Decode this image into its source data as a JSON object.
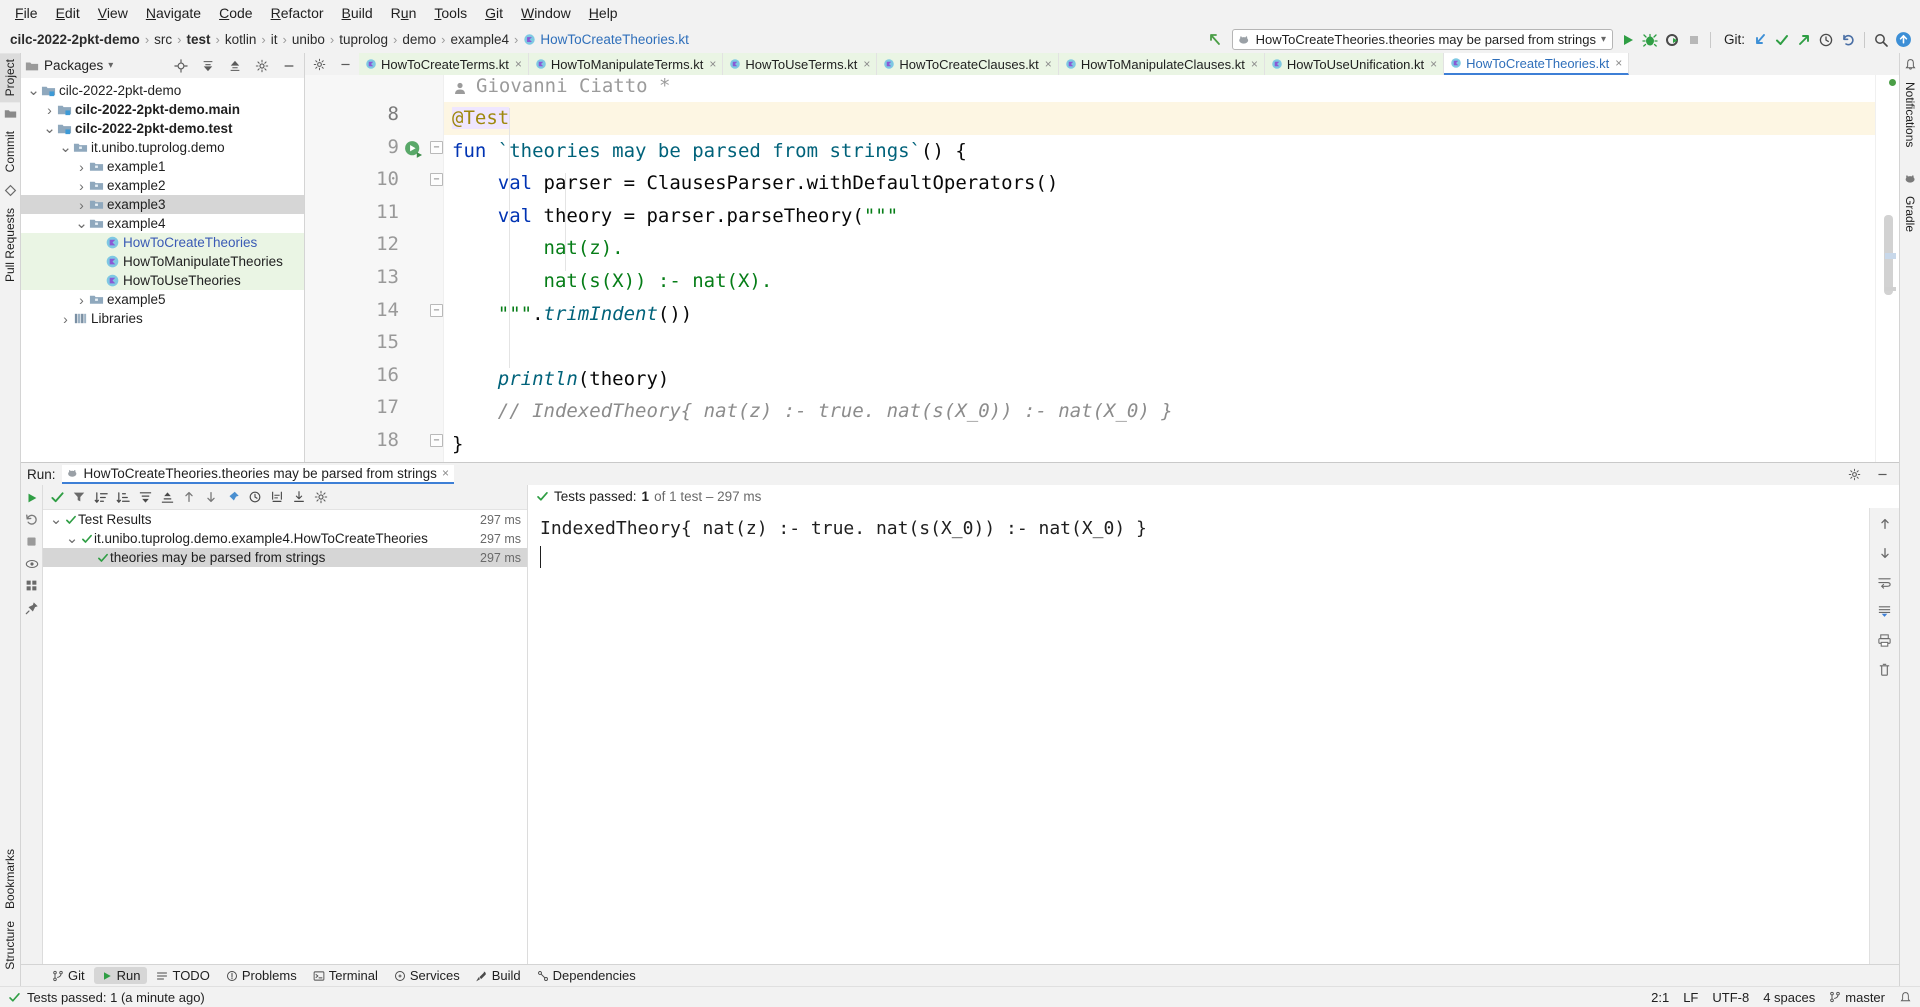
{
  "menu": {
    "items": [
      {
        "label": "File",
        "mn": "F"
      },
      {
        "label": "Edit",
        "mn": "E"
      },
      {
        "label": "View",
        "mn": "V"
      },
      {
        "label": "Navigate",
        "mn": "N"
      },
      {
        "label": "Code",
        "mn": "C"
      },
      {
        "label": "Refactor",
        "mn": "R"
      },
      {
        "label": "Build",
        "mn": "B"
      },
      {
        "label": "Run",
        "mn": "u"
      },
      {
        "label": "Tools",
        "mn": "T"
      },
      {
        "label": "Git",
        "mn": "G"
      },
      {
        "label": "Window",
        "mn": "W"
      },
      {
        "label": "Help",
        "mn": "H"
      }
    ]
  },
  "breadcrumb": {
    "items": [
      "cilc-2022-2pkt-demo",
      "src",
      "test",
      "kotlin",
      "it",
      "unibo",
      "tuprolog",
      "demo",
      "example4",
      "HowToCreateTheories.kt"
    ],
    "bold_indices": [
      0,
      2
    ],
    "link_index": 9,
    "separator": "›"
  },
  "toolbar": {
    "run_config": "HowToCreateTheories.theories may be parsed from strings",
    "run_config_dropdown": "▾",
    "run_label": "Run",
    "debug_label": "Debug",
    "coverage_label": "Run with Coverage",
    "stop_label": "Stop",
    "git_label": "Git:",
    "git_update_label": "Update Project",
    "git_commit_label": "Commit",
    "git_push_label": "Push",
    "git_history_label": "History",
    "git_revert_label": "Rollback",
    "search_label": "Search Everywhere",
    "account_label": "Account"
  },
  "left_stripe": {
    "project_tab": "Project",
    "commit_tab": "Commit",
    "pull_requests_tab": "Pull Requests",
    "bookmarks_tab": "Bookmarks",
    "structure_tab": "Structure"
  },
  "right_stripe": {
    "notifications_tab": "Notifications",
    "gradle_tab": "Gradle"
  },
  "project_panel": {
    "title": "Packages",
    "title_dropdown": "▾",
    "locate_label": "Select Opened File",
    "expand_label": "Expand All",
    "collapse_label": "Collapse All",
    "settings_label": "Options",
    "hide_label": "Hide",
    "tree": [
      {
        "label": "cilc-2022-2pkt-demo",
        "indent": 0,
        "arrow": "down",
        "icon": "module",
        "bold": false,
        "state": "normal"
      },
      {
        "label": "cilc-2022-2pkt-demo.main",
        "indent": 1,
        "arrow": "right",
        "icon": "module",
        "bold": true,
        "state": "normal"
      },
      {
        "label": "cilc-2022-2pkt-demo.test",
        "indent": 1,
        "arrow": "down",
        "icon": "module",
        "bold": true,
        "state": "normal"
      },
      {
        "label": "it.unibo.tuprolog.demo",
        "indent": 2,
        "arrow": "down",
        "icon": "package",
        "bold": false,
        "state": "normal"
      },
      {
        "label": "example1",
        "indent": 3,
        "arrow": "right",
        "icon": "package",
        "bold": false,
        "state": "normal"
      },
      {
        "label": "example2",
        "indent": 3,
        "arrow": "right",
        "icon": "package",
        "bold": false,
        "state": "normal"
      },
      {
        "label": "example3",
        "indent": 3,
        "arrow": "right",
        "icon": "package",
        "bold": false,
        "state": "selected"
      },
      {
        "label": "example4",
        "indent": 3,
        "arrow": "down",
        "icon": "package",
        "bold": false,
        "state": "normal"
      },
      {
        "label": "HowToCreateTheories",
        "indent": 4,
        "arrow": "none",
        "icon": "kotlin-class",
        "bold": false,
        "state": "green",
        "link": true
      },
      {
        "label": "HowToManipulateTheories",
        "indent": 4,
        "arrow": "none",
        "icon": "kotlin-class",
        "bold": false,
        "state": "green"
      },
      {
        "label": "HowToUseTheories",
        "indent": 4,
        "arrow": "none",
        "icon": "kotlin-class",
        "bold": false,
        "state": "green"
      },
      {
        "label": "example5",
        "indent": 3,
        "arrow": "right",
        "icon": "package",
        "bold": false,
        "state": "normal"
      },
      {
        "label": "Libraries",
        "indent": 2,
        "arrow": "right",
        "icon": "library",
        "bold": false,
        "state": "normal"
      }
    ]
  },
  "editor": {
    "tabs": [
      {
        "label": "HowToCreateTerms.kt",
        "active": false
      },
      {
        "label": "HowToManipulateTerms.kt",
        "active": false
      },
      {
        "label": "HowToUseTerms.kt",
        "active": false
      },
      {
        "label": "HowToCreateClauses.kt",
        "active": false
      },
      {
        "label": "HowToManipulateClauses.kt",
        "active": false
      },
      {
        "label": "HowToUseUnification.kt",
        "active": false
      },
      {
        "label": "HowToCreateTheories.kt",
        "active": true
      }
    ],
    "tab_close": "×",
    "settings_label": "Settings",
    "hide_label": "Hide",
    "author_hint": "Giovanni Ciatto *",
    "line_numbers": [
      "8",
      "9",
      "10",
      "11",
      "12",
      "13",
      "14",
      "15",
      "16",
      "17",
      "18"
    ],
    "lines": [
      {
        "n": "8",
        "tokens": [
          {
            "t": "@Test",
            "c": "ann"
          }
        ],
        "highlight": true
      },
      {
        "n": "9",
        "tokens": [
          {
            "t": "fun ",
            "c": "kw"
          },
          {
            "t": "`theories may be parsed from strings`",
            "c": "fn"
          },
          {
            "t": "() {",
            "c": "plain"
          }
        ]
      },
      {
        "n": "10",
        "tokens": [
          {
            "t": "    val ",
            "c": "kw"
          },
          {
            "t": "parser = ClausesParser.withDefaultOperators()",
            "c": "plain"
          }
        ]
      },
      {
        "n": "11",
        "tokens": [
          {
            "t": "    val ",
            "c": "kw"
          },
          {
            "t": "theory = parser.parseTheory(",
            "c": "plain"
          },
          {
            "t": "\"\"\"",
            "c": "str"
          }
        ]
      },
      {
        "n": "12",
        "tokens": [
          {
            "t": "        nat(z).",
            "c": "str"
          }
        ]
      },
      {
        "n": "13",
        "tokens": [
          {
            "t": "        nat(s(X)) :- nat(X).",
            "c": "str"
          }
        ]
      },
      {
        "n": "14",
        "tokens": [
          {
            "t": "    \"\"\"",
            "c": "str"
          },
          {
            "t": ".",
            "c": "plain"
          },
          {
            "t": "trimIndent",
            "c": "ital"
          },
          {
            "t": "())",
            "c": "plain"
          }
        ]
      },
      {
        "n": "15",
        "tokens": []
      },
      {
        "n": "16",
        "tokens": [
          {
            "t": "    ",
            "c": "plain"
          },
          {
            "t": "println",
            "c": "ital"
          },
          {
            "t": "(theory)",
            "c": "plain"
          }
        ]
      },
      {
        "n": "17",
        "tokens": [
          {
            "t": "    // IndexedTheory{ nat(z) :- true. nat(s(X_0)) :- nat(X_0) }",
            "c": "com"
          }
        ]
      },
      {
        "n": "18",
        "tokens": [
          {
            "t": "}",
            "c": "plain"
          }
        ]
      }
    ]
  },
  "run_window": {
    "title": "Run:",
    "tab_label": "HowToCreateTheories.theories may be parsed from strings",
    "tab_close": "×",
    "settings_label": "Settings",
    "hide_label": "Hide",
    "toolbar": {
      "rerun_label": "Rerun",
      "rerun_failed_label": "Rerun Failed Tests",
      "toggle_label": "Toggle auto-test",
      "stop_label": "Stop",
      "pin_label": "Pin Tab"
    },
    "tests_toolbar": {
      "show_passed_label": "Show Passed",
      "sort_alpha_label": "Sort Alphabetically",
      "sort_duration_label": "Sort by Duration",
      "expand_label": "Expand All",
      "collapse_label": "Collapse All",
      "prev_label": "Previous Failed Test",
      "next_label": "Next Failed Test",
      "filter_label": "Filter",
      "history_label": "Test History",
      "export_label": "Export Results",
      "import_label": "Import Results",
      "settings_label": "Settings"
    },
    "tests": [
      {
        "label": "Test Results",
        "duration": "297 ms",
        "indent": 0,
        "arrow": "down",
        "state": "normal"
      },
      {
        "label": "it.unibo.tuprolog.demo.example4.HowToCreateTheories",
        "duration": "297 ms",
        "indent": 1,
        "arrow": "down",
        "state": "normal"
      },
      {
        "label": "theories may be parsed from strings",
        "duration": "297 ms",
        "indent": 2,
        "arrow": "none",
        "state": "selected"
      }
    ],
    "status": {
      "prefix": "Tests passed:",
      "count": "1",
      "suffix": "of 1 test – 297 ms"
    },
    "console_output": "IndexedTheory{ nat(z) :- true. nat(s(X_0)) :- nat(X_0) }",
    "console_side": {
      "up_label": "Up the Stack Trace",
      "down_label": "Down the Stack Trace",
      "soft_wrap_label": "Soft-Wrap",
      "scroll_end_label": "Scroll to End",
      "print_label": "Print",
      "clear_label": "Clear All"
    }
  },
  "bottom_bar": {
    "items": [
      {
        "label": "Git",
        "icon": "git-icon",
        "selected": false
      },
      {
        "label": "Run",
        "icon": "run-icon",
        "selected": true
      },
      {
        "label": "TODO",
        "icon": "todo-icon",
        "selected": false
      },
      {
        "label": "Problems",
        "icon": "problems-icon",
        "selected": false
      },
      {
        "label": "Terminal",
        "icon": "terminal-icon",
        "selected": false
      },
      {
        "label": "Services",
        "icon": "services-icon",
        "selected": false
      },
      {
        "label": "Build",
        "icon": "build-icon",
        "selected": false
      },
      {
        "label": "Dependencies",
        "icon": "dependencies-icon",
        "selected": false
      }
    ]
  },
  "status_bar": {
    "message": "Tests passed: 1 (a minute ago)",
    "caret_position": "2:1",
    "line_separator": "LF",
    "encoding": "UTF-8",
    "indent": "4 spaces",
    "branch": "master"
  },
  "colors": {
    "accent": "#3d7fd6",
    "green": "#4a9e46",
    "link": "#2f6fba",
    "keyword": "#0033b3",
    "string": "#067d17",
    "comment": "#8c8c8c",
    "annotation": "#9e880d",
    "teal": "#00627a",
    "highlight_row": "#fdf6e3",
    "green_row": "#eaf5e4"
  }
}
